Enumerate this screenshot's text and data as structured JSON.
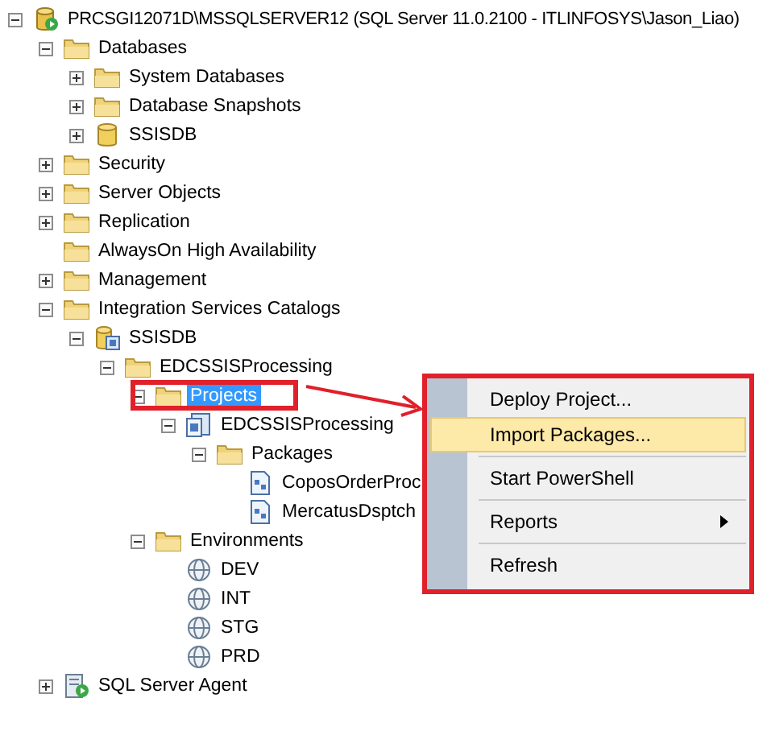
{
  "tree": [
    {
      "label": "PRCSGI12071D\\MSSQLSERVER12 (SQL Server 11.0.2100 - ITLINFOSYS\\Jason_Liao)",
      "kind": "server",
      "expanded": true,
      "selected": false,
      "children": [
        {
          "label": "Databases",
          "kind": "folder",
          "expanded": true,
          "selected": false,
          "children": [
            {
              "label": "System Databases",
              "kind": "folder",
              "expanded": false,
              "selected": false
            },
            {
              "label": "Database Snapshots",
              "kind": "folder",
              "expanded": false,
              "selected": false
            },
            {
              "label": "SSISDB",
              "kind": "database",
              "expanded": false,
              "selected": false
            }
          ]
        },
        {
          "label": "Security",
          "kind": "folder",
          "expanded": false,
          "selected": false
        },
        {
          "label": "Server Objects",
          "kind": "folder",
          "expanded": false,
          "selected": false
        },
        {
          "label": "Replication",
          "kind": "folder",
          "expanded": false,
          "selected": false
        },
        {
          "label": "AlwaysOn High Availability",
          "kind": "folder",
          "selected": false
        },
        {
          "label": "Management",
          "kind": "folder",
          "expanded": false,
          "selected": false
        },
        {
          "label": "Integration Services Catalogs",
          "kind": "folder",
          "expanded": true,
          "selected": false,
          "children": [
            {
              "label": "SSISDB",
              "kind": "catalog",
              "expanded": true,
              "selected": false,
              "children": [
                {
                  "label": "EDCSSISProcessing",
                  "kind": "folder",
                  "expanded": true,
                  "selected": false,
                  "children": [
                    {
                      "label": "Projects",
                      "kind": "folder",
                      "expanded": true,
                      "selected": true,
                      "children": [
                        {
                          "label": "EDCSSISProcessing",
                          "kind": "project",
                          "expanded": true,
                          "selected": false,
                          "children": [
                            {
                              "label": "Packages",
                              "kind": "folder",
                              "expanded": true,
                              "selected": false,
                              "children": [
                                {
                                  "label": "CoposOrderProc",
                                  "kind": "package",
                                  "selected": false
                                },
                                {
                                  "label": "MercatusDsptch",
                                  "kind": "package",
                                  "selected": false
                                }
                              ]
                            }
                          ]
                        }
                      ]
                    },
                    {
                      "label": "Environments",
                      "kind": "folder",
                      "expanded": true,
                      "selected": false,
                      "children": [
                        {
                          "label": "DEV",
                          "kind": "environment",
                          "selected": false
                        },
                        {
                          "label": "INT",
                          "kind": "environment",
                          "selected": false
                        },
                        {
                          "label": "STG",
                          "kind": "environment",
                          "selected": false
                        },
                        {
                          "label": "PRD",
                          "kind": "environment",
                          "selected": false
                        }
                      ]
                    }
                  ]
                }
              ]
            }
          ]
        },
        {
          "label": "SQL Server Agent",
          "kind": "agent",
          "expanded": false,
          "selected": false
        }
      ]
    }
  ],
  "context_menu": [
    {
      "kind": "item",
      "label": "Deploy Project...",
      "selected": false,
      "submenu": false
    },
    {
      "kind": "item",
      "label": "Import Packages...",
      "selected": true,
      "submenu": false
    },
    {
      "kind": "separator"
    },
    {
      "kind": "item",
      "label": "Start PowerShell",
      "selected": false,
      "submenu": false
    },
    {
      "kind": "separator"
    },
    {
      "kind": "item",
      "label": "Reports",
      "selected": false,
      "submenu": true
    },
    {
      "kind": "separator"
    },
    {
      "kind": "item",
      "label": "Refresh",
      "selected": false,
      "submenu": false
    }
  ]
}
